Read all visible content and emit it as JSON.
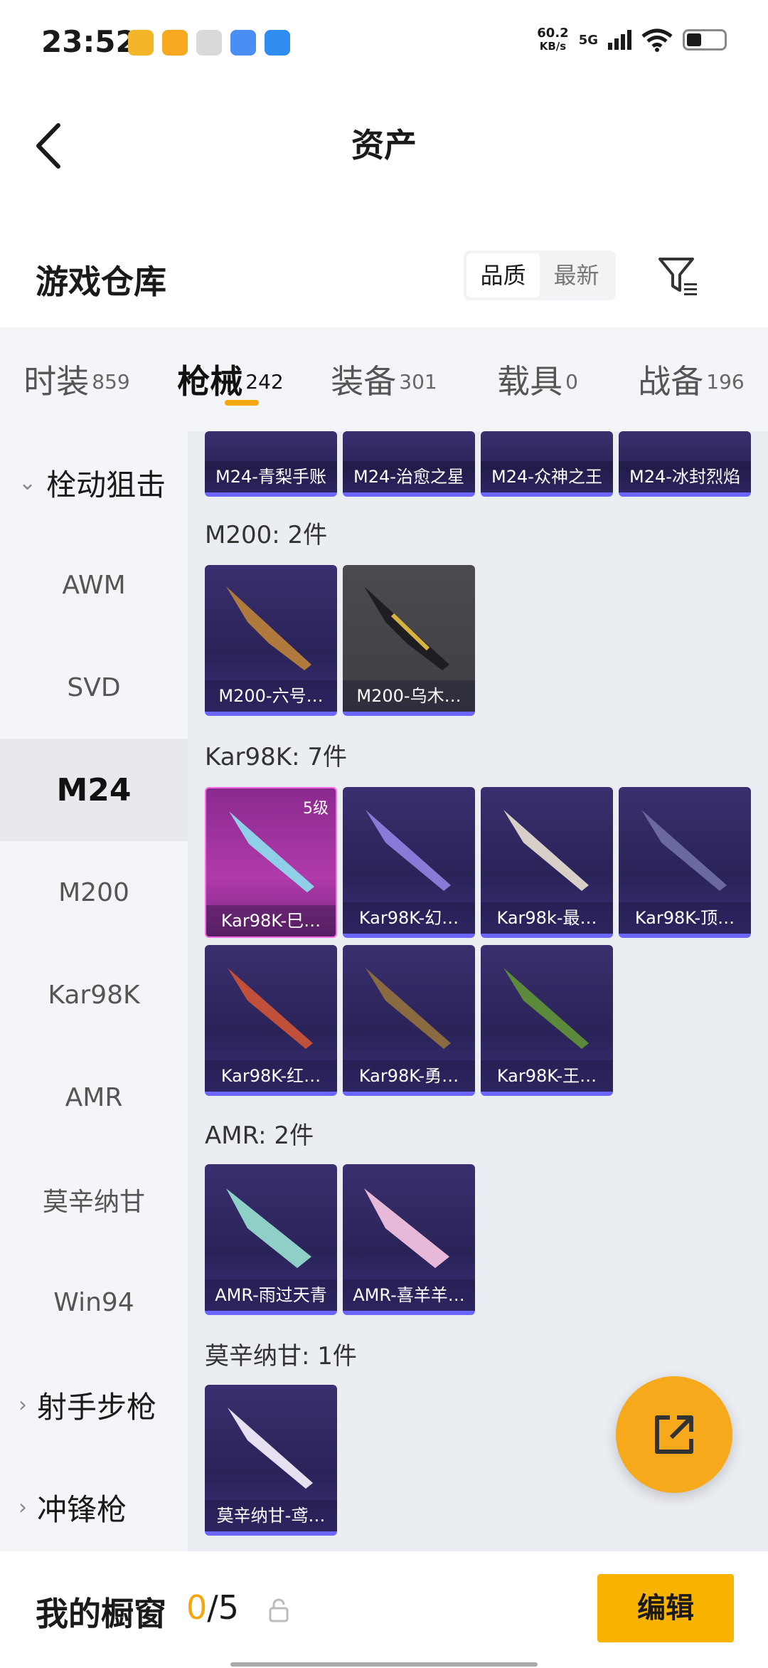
{
  "status_bar": {
    "time": "23:52",
    "net_speed_value": "60.2",
    "net_speed_unit": "KB/s",
    "network": "5G",
    "icons": [
      "app-icon-1",
      "app-icon-2",
      "settings-icon",
      "app-icon-4",
      "app-icon-5",
      "signal-icon",
      "wifi-icon",
      "battery-icon"
    ]
  },
  "header": {
    "title": "资产",
    "back_icon": "back-arrow-icon"
  },
  "warehouse": {
    "title": "游戏仓库",
    "sort_options": [
      "品质",
      "最新"
    ],
    "sort_selected": "品质",
    "filter_icon": "filter-icon"
  },
  "tabs": [
    {
      "label": "时装",
      "count": "859"
    },
    {
      "label": "枪械",
      "count": "242",
      "active": true
    },
    {
      "label": "装备",
      "count": "301"
    },
    {
      "label": "载具",
      "count": "0"
    },
    {
      "label": "战备",
      "count": "196"
    }
  ],
  "sidebar": {
    "group_sniper": "栓动狙击",
    "items": [
      "AWM",
      "SVD",
      "M24",
      "M200",
      "Kar98K",
      "AMR",
      "莫辛纳甘",
      "Win94"
    ],
    "selected": "M24",
    "group_marksman": "射手步枪",
    "group_smg": "冲锋枪"
  },
  "sections": {
    "m24_items": [
      "M24-青梨手账",
      "M24-治愈之星",
      "M24-众神之王",
      "M24-冰封烈焰"
    ],
    "m200_title": "M200: 2件",
    "m200_items": [
      "M200-六号…",
      "M200-乌木…"
    ],
    "kar_title": "Kar98K: 7件",
    "kar_items": [
      "Kar98K-巳…",
      "Kar98K-幻…",
      "Kar98k-最…",
      "Kar98K-顶…",
      "Kar98K-红…",
      "Kar98K-勇…",
      "Kar98K-王…"
    ],
    "kar_level": "5级",
    "amr_title": "AMR: 2件",
    "amr_items": [
      "AMR-雨过天青",
      "AMR-喜羊羊…"
    ],
    "mosin_title": "莫辛纳甘: 1件",
    "mosin_items": [
      "莫辛纳甘-鸢…"
    ]
  },
  "bottom": {
    "label": "我的橱窗",
    "current": "0",
    "total": "/5",
    "edit": "编辑"
  },
  "colors": {
    "accent": "#f5a70d",
    "card_purple": "#2a2358",
    "card_pink": "#b03aaa"
  }
}
